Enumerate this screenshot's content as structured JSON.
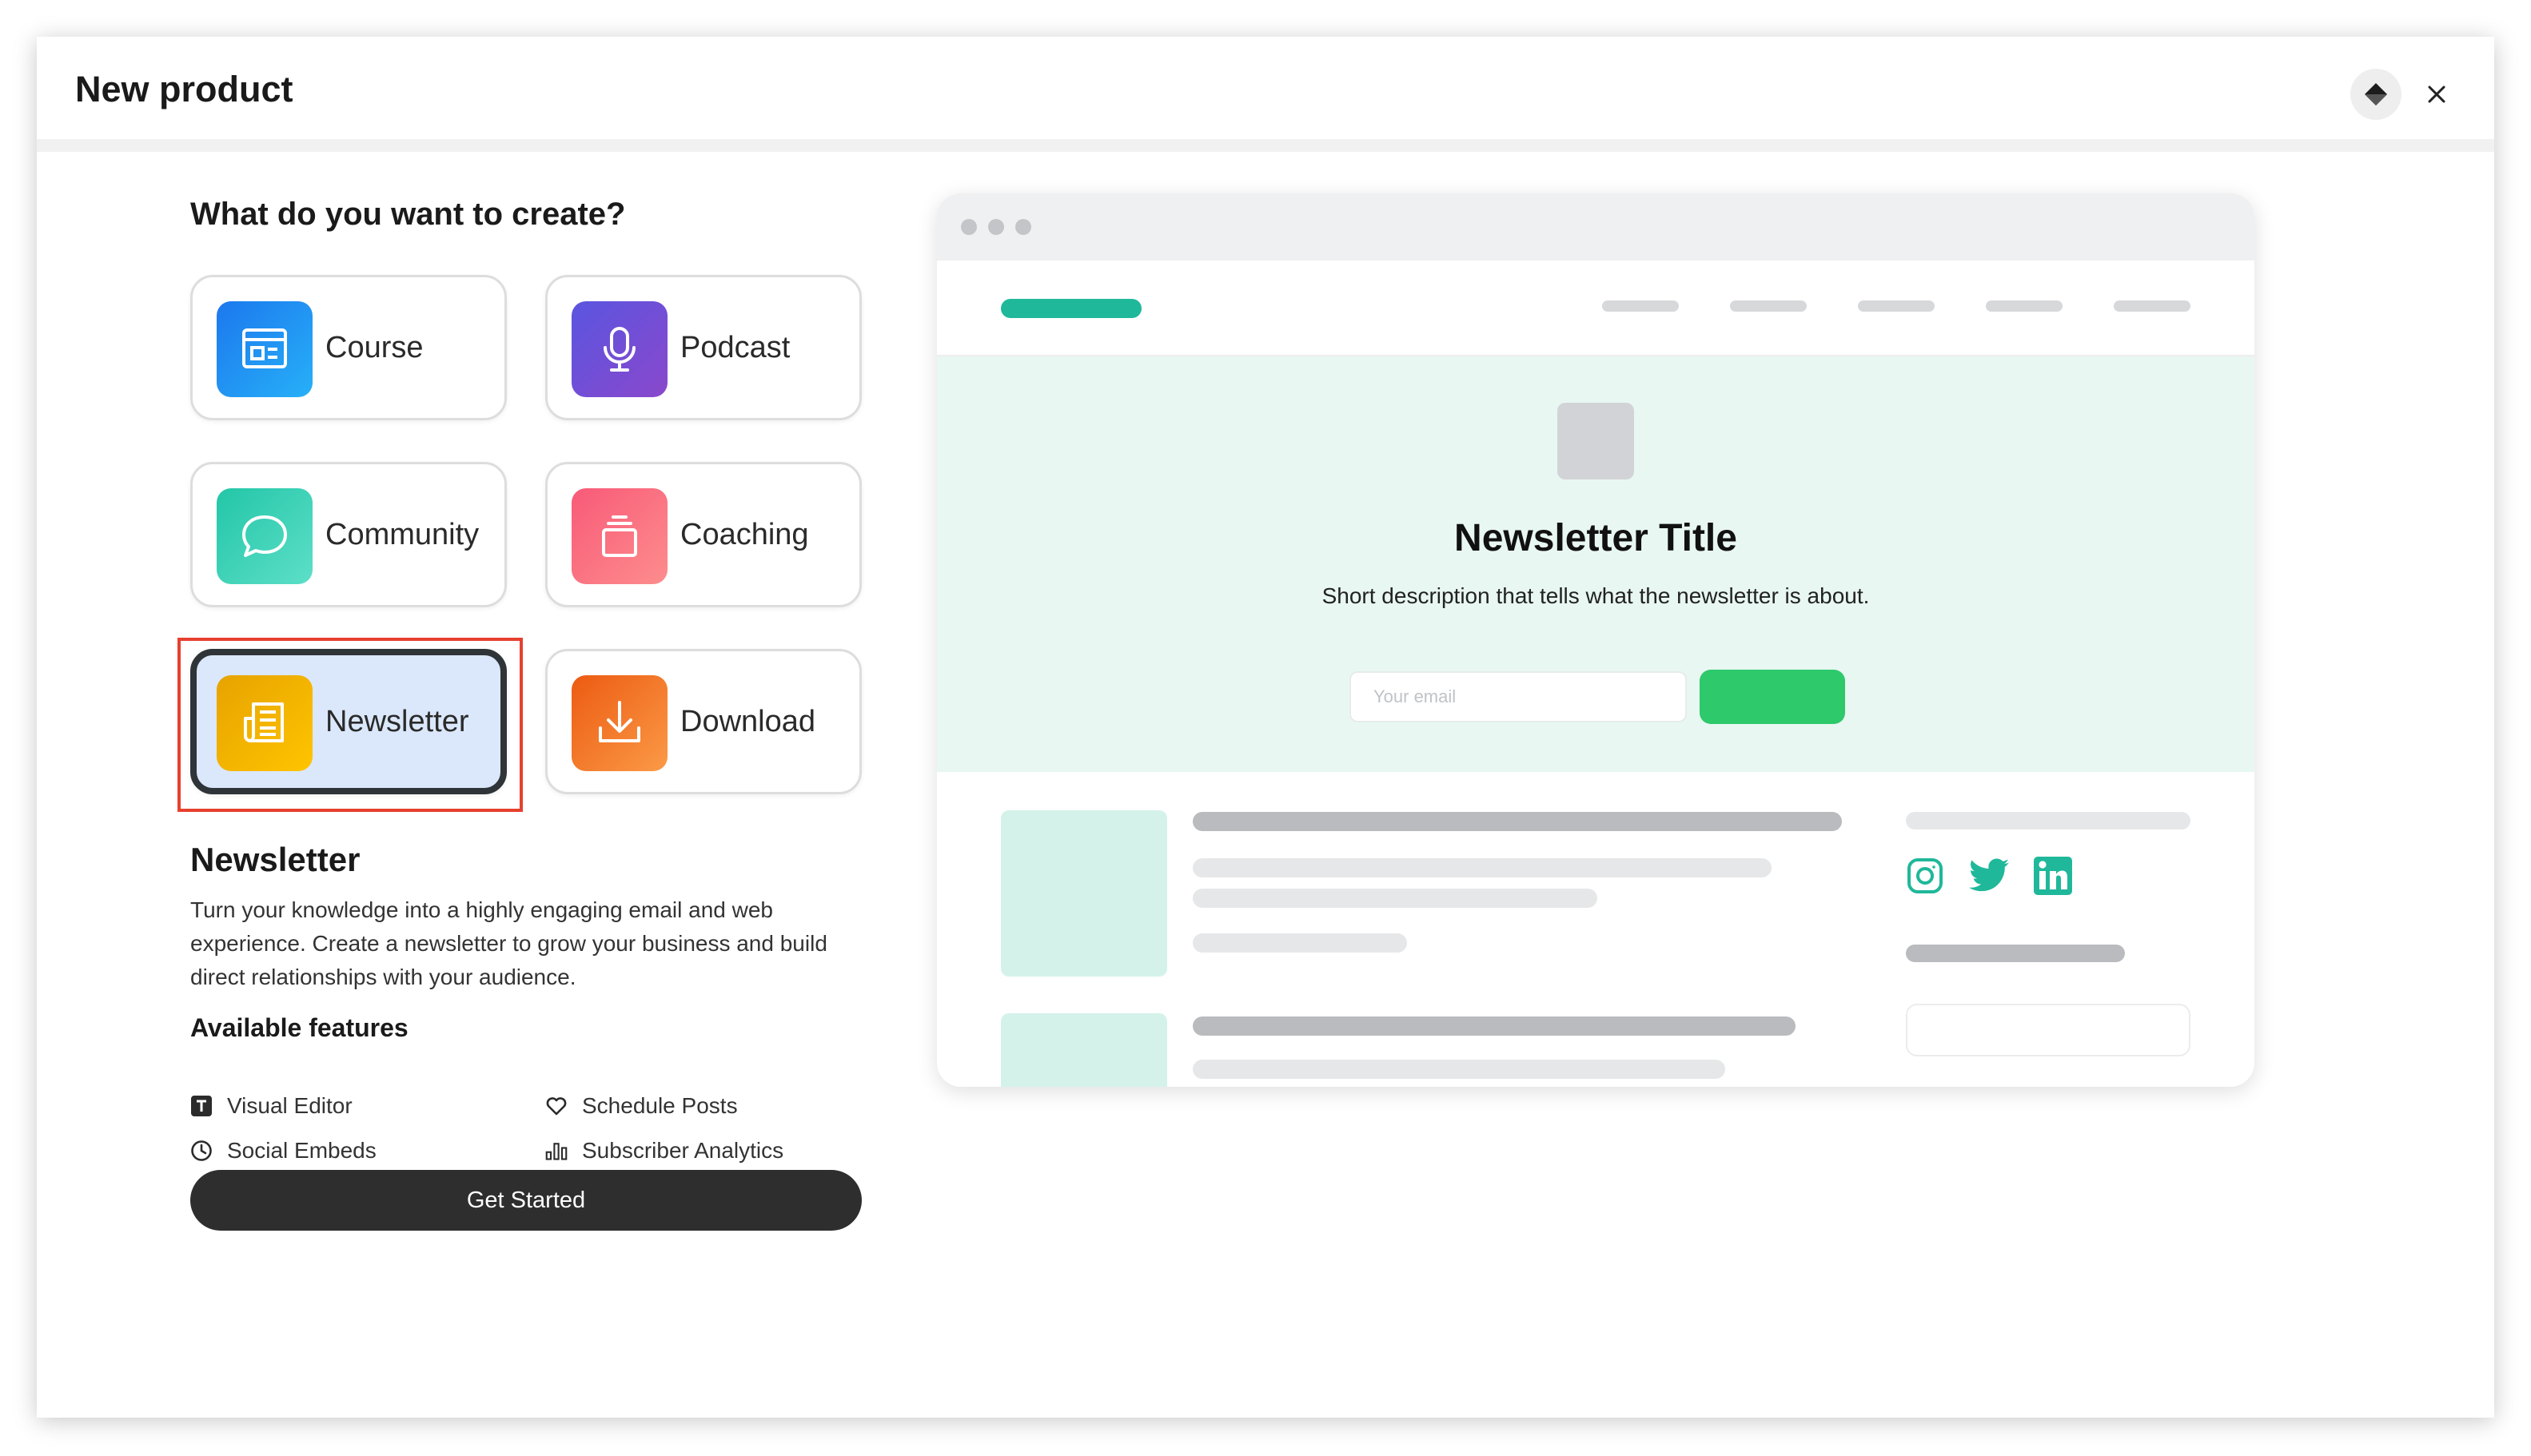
{
  "dialog": {
    "title": "New product",
    "ai_icon": "sparkle-diamond-icon",
    "close_icon": "close-icon"
  },
  "chooser": {
    "question": "What do you want to create?",
    "options": [
      {
        "label": "Course",
        "icon": "course-window-icon",
        "color": "#1e8cf3"
      },
      {
        "label": "Podcast",
        "icon": "microphone-icon",
        "color": "#6d4fd4"
      },
      {
        "label": "Community",
        "icon": "speech-bubble-icon",
        "color": "#2fcdb1"
      },
      {
        "label": "Coaching",
        "icon": "coaching-stack-icon",
        "color": "#f9657f"
      },
      {
        "label": "Newsletter",
        "icon": "newspaper-icon",
        "color": "#f2b500",
        "selected": true
      },
      {
        "label": "Download",
        "icon": "download-icon",
        "color": "#f06a1d"
      }
    ]
  },
  "details": {
    "title": "Newsletter",
    "description": "Turn your knowledge into a highly engaging email and web experience. Create a newsletter to grow your business and build direct relationships with your audience.",
    "features_title": "Available features",
    "features": [
      {
        "label": "Visual Editor",
        "icon": "text-editor-icon"
      },
      {
        "label": "Schedule Posts",
        "icon": "heart-icon"
      },
      {
        "label": "Social Embeds",
        "icon": "clock-icon"
      },
      {
        "label": "Subscriber Analytics",
        "icon": "bar-chart-icon"
      }
    ],
    "cta": "Get Started"
  },
  "preview": {
    "hero_title": "Newsletter Title",
    "hero_subtitle": "Short description that tells what the newsletter is about.",
    "email_placeholder": "Your email",
    "brand_color": "#1fb89a",
    "button_color": "#2dc96b",
    "social_icons": [
      "instagram-icon",
      "twitter-icon",
      "linkedin-icon"
    ]
  }
}
